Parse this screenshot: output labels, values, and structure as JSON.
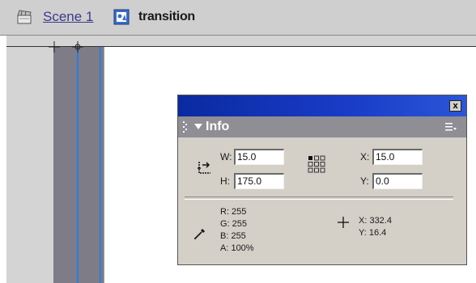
{
  "breadcrumb": {
    "scene_label": "Scene 1",
    "symbol_label": "transition",
    "scene_icon": "clapperboard-icon",
    "symbol_icon": "movie-clip-symbol-icon"
  },
  "info_panel": {
    "title": "Info",
    "close_label": "x",
    "dimensions": {
      "w_label": "W:",
      "w_value": "15.0",
      "h_label": "H:",
      "h_value": "175.0"
    },
    "position": {
      "x_label": "X:",
      "x_value": "15.0",
      "y_label": "Y:",
      "y_value": "0.0"
    },
    "color": {
      "r_label": "R: 255",
      "g_label": "G: 255",
      "b_label": "B: 255",
      "a_label": "A: 100%"
    },
    "cursor": {
      "x_label": "X: 332.4",
      "y_label": "Y: 16.4"
    }
  },
  "colors": {
    "titlebar": "#0a2aa0",
    "selection": "#2a7de0",
    "panel_bg": "#d4d0c8"
  }
}
